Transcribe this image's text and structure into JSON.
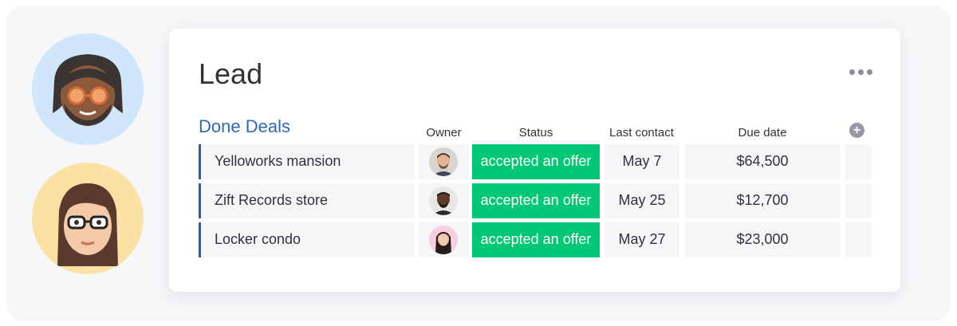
{
  "board": {
    "title": "Lead",
    "group_title": "Done Deals",
    "columns": {
      "owner": "Owner",
      "status": "Status",
      "last_contact": "Last contact",
      "due_date": "Due date"
    },
    "add_column_icon": "plus-circle-icon",
    "more_icon": "more-horizontal-icon",
    "status_color": "#00c875",
    "group_color": "#2d6bb4",
    "rows": [
      {
        "name": "Yelloworks mansion",
        "status": "accepted an offer",
        "last_contact": "May 7",
        "due_date": "$64,500"
      },
      {
        "name": "Zift Records store",
        "status": "accepted an offer",
        "last_contact": "May 25",
        "due_date": "$12,700"
      },
      {
        "name": "Locker condo",
        "status": "accepted an offer",
        "last_contact": "May 27",
        "due_date": "$23,000"
      }
    ]
  }
}
